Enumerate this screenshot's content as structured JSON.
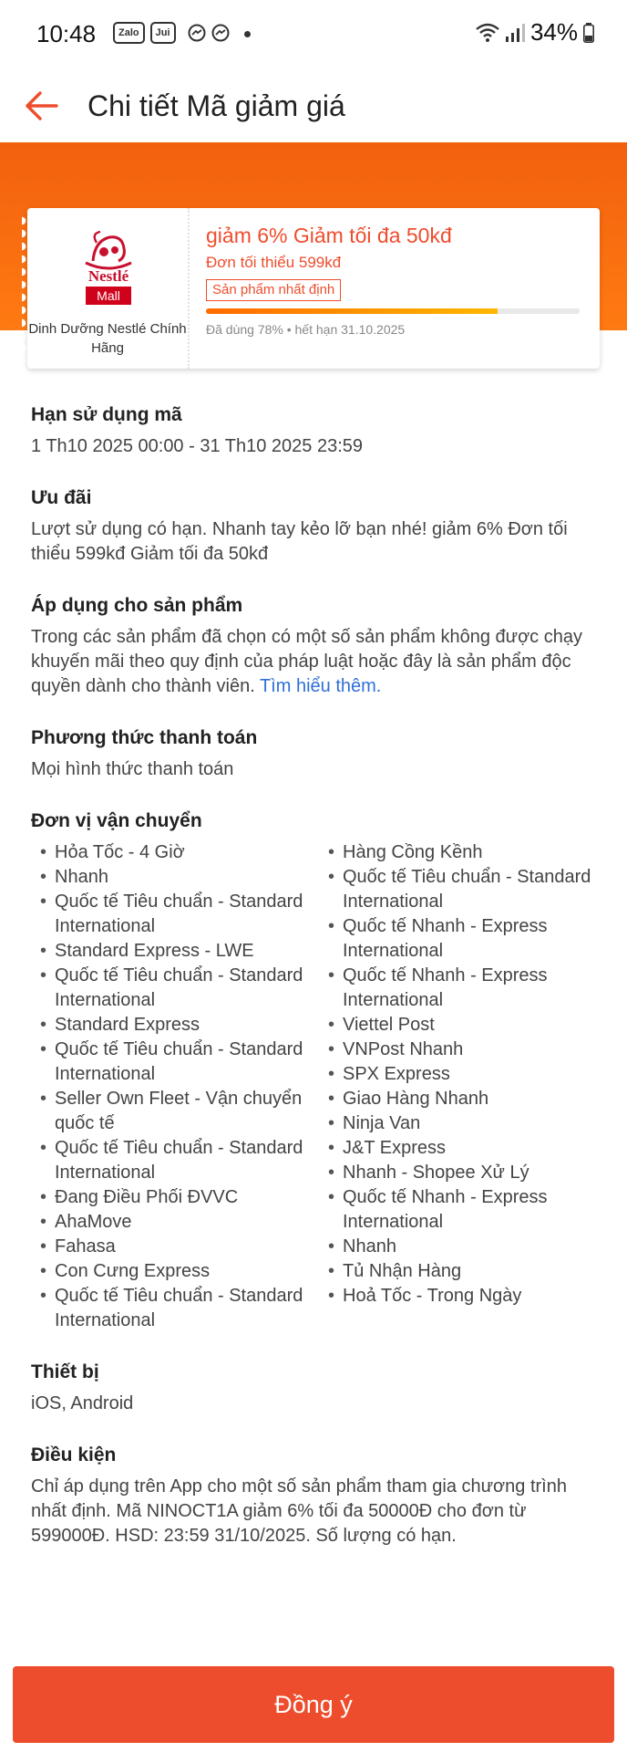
{
  "status_bar": {
    "time": "10:48",
    "apps": [
      "Zalo",
      "Jui"
    ],
    "battery": "34%"
  },
  "header": {
    "title": "Chi tiết Mã giảm giá"
  },
  "voucher": {
    "brand_logo_text": "Nestlé",
    "brand_badge": "Mall",
    "brand_name": "Dinh Dưỡng Nestlé Chính Hãng",
    "title": "giảm 6% Giảm tối đa 50kđ",
    "min_order": "Đơn tối thiểu 599kđ",
    "tag": "Sản phẩm nhất định",
    "used_percent": 78,
    "usage_text": "Đã dùng 78% • hết hạn 31.10.2025"
  },
  "sections": {
    "validity": {
      "title": "Hạn sử dụng mã",
      "body": "1 Th10 2025 00:00 - 31 Th10 2025 23:59"
    },
    "offer": {
      "title": "Ưu đãi",
      "body": "Lượt sử dụng có hạn. Nhanh tay kẻo lỡ bạn nhé! giảm 6% Đơn tối thiểu 599kđ Giảm tối đa 50kđ"
    },
    "products": {
      "title": "Áp dụng cho sản phẩm",
      "body": "Trong các sản phẩm đã chọn có một số sản phẩm không được chạy khuyến mãi theo quy định của pháp luật hoặc đây là sản phẩm độc quyền dành cho thành viên. ",
      "link": "Tìm hiểu thêm."
    },
    "payment": {
      "title": "Phương thức thanh toán",
      "body": "Mọi hình thức thanh toán"
    },
    "shipping": {
      "title": "Đơn vị vận chuyển",
      "left": [
        "Hỏa Tốc - 4 Giờ",
        "Nhanh",
        "Quốc tế Tiêu chuẩn - Standard International",
        "Standard Express - LWE",
        "Quốc tế Tiêu chuẩn - Standard International",
        "Standard Express",
        "Quốc tế Tiêu chuẩn - Standard International",
        "Seller Own Fleet - Vận chuyển quốc tế",
        "Quốc tế Tiêu chuẩn - Standard International",
        "Đang Điều Phối ĐVVC",
        "AhaMove",
        "Fahasa",
        "Con Cưng Express",
        "Quốc tế Tiêu chuẩn - Standard International"
      ],
      "right": [
        "Hàng Cồng Kềnh",
        "Quốc tế Tiêu chuẩn - Standard International",
        "Quốc tế Nhanh - Express International",
        "Quốc tế Nhanh - Express International",
        "Viettel Post",
        "VNPost Nhanh",
        "SPX Express",
        "Giao Hàng Nhanh",
        "Ninja Van",
        "J&T Express",
        "Nhanh - Shopee Xử Lý",
        "Quốc tế Nhanh - Express International",
        "Nhanh",
        "Tủ Nhận Hàng",
        "Hoả Tốc - Trong Ngày"
      ]
    },
    "device": {
      "title": "Thiết bị",
      "body": "iOS, Android"
    },
    "conditions": {
      "title": "Điều kiện",
      "body": "Chỉ áp dụng trên App cho một số sản phẩm tham gia chương trình nhất định. Mã NINOCT1A giảm 6% tối đa 50000Đ cho đơn từ 599000Đ. HSD: 23:59 31/10/2025. Số lượng có hạn."
    }
  },
  "footer": {
    "agree_label": "Đồng ý"
  },
  "colors": {
    "accent": "#ee4d2d",
    "banner": "#f2600e",
    "link": "#2f6fd6"
  }
}
